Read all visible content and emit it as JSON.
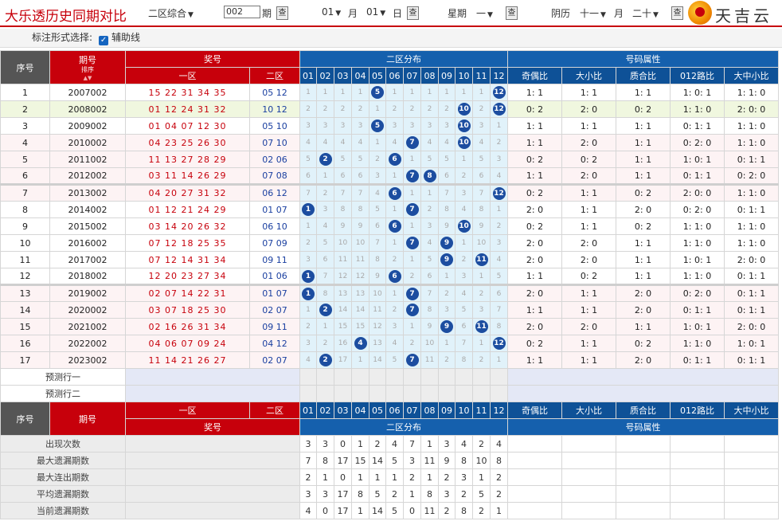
{
  "header": {
    "title": "大乐透历史同期对比",
    "zone_select": "二区综合",
    "period_input": "002",
    "period_label": "期",
    "query_label": "查",
    "month_value": "01",
    "month_label": "月",
    "day_value": "01",
    "day_label": "日",
    "weekday_label": "星期",
    "weekday_value": "一",
    "lunar_label": "阴历",
    "lunar_month": "十一",
    "lunar_month_label": "月",
    "lunar_day": "二十",
    "logo_text": "天吉云"
  },
  "options": {
    "label": "标注形式选择:",
    "checkbox_label": "辅助线",
    "checked": true
  },
  "table": {
    "head1": {
      "seq": "序号",
      "period": "期号",
      "sort": "排序",
      "prize": "奖号",
      "dist": "二区分布",
      "attrs": "号码属性"
    },
    "head2": {
      "zone1": "一区",
      "zone2": "二区",
      "nums": [
        "01",
        "02",
        "03",
        "04",
        "05",
        "06",
        "07",
        "08",
        "09",
        "10",
        "11",
        "12"
      ],
      "attr_cols": [
        "奇偶比",
        "大小比",
        "质合比",
        "012路比",
        "大中小比"
      ]
    },
    "rows": [
      {
        "seq": "1",
        "period": "2007002",
        "front": "15 22 31 34 35",
        "back": "05 12",
        "dist": [
          "1",
          "1",
          "1",
          "1",
          "5",
          "1",
          "1",
          "1",
          "1",
          "1",
          "1",
          "12"
        ],
        "hits": [
          5,
          12
        ],
        "attrs": [
          "1: 1",
          "1: 1",
          "1: 1",
          "1: 0: 1",
          "1: 1: 0"
        ]
      },
      {
        "seq": "2",
        "period": "2008002",
        "front": "01 12 24 31 32",
        "back": "10 12",
        "dist": [
          "2",
          "2",
          "2",
          "2",
          "1",
          "2",
          "2",
          "2",
          "2",
          "10",
          "2",
          "12"
        ],
        "hits": [
          10,
          12
        ],
        "attrs": [
          "0: 2",
          "2: 0",
          "0: 2",
          "1: 1: 0",
          "2: 0: 0"
        ]
      },
      {
        "seq": "3",
        "period": "2009002",
        "front": "01 04 07 12 30",
        "back": "05 10",
        "dist": [
          "3",
          "3",
          "3",
          "3",
          "5",
          "3",
          "3",
          "3",
          "3",
          "10",
          "3",
          "1"
        ],
        "hits": [
          5,
          10
        ],
        "attrs": [
          "1: 1",
          "1: 1",
          "1: 1",
          "0: 1: 1",
          "1: 1: 0"
        ]
      },
      {
        "seq": "4",
        "period": "2010002",
        "front": "04 23 25 26 30",
        "back": "07 10",
        "dist": [
          "4",
          "4",
          "4",
          "4",
          "1",
          "4",
          "7",
          "4",
          "4",
          "10",
          "4",
          "2"
        ],
        "hits": [
          7,
          10
        ],
        "attrs": [
          "1: 1",
          "2: 0",
          "1: 1",
          "0: 2: 0",
          "1: 1: 0"
        ]
      },
      {
        "seq": "5",
        "period": "2011002",
        "front": "11 13 27 28 29",
        "back": "02 06",
        "dist": [
          "5",
          "2",
          "5",
          "5",
          "2",
          "6",
          "1",
          "5",
          "5",
          "1",
          "5",
          "3"
        ],
        "hits": [
          2,
          6
        ],
        "attrs": [
          "0: 2",
          "0: 2",
          "1: 1",
          "1: 0: 1",
          "0: 1: 1"
        ]
      },
      {
        "seq": "6",
        "period": "2012002",
        "front": "03 11 14 26 29",
        "back": "07 08",
        "dist": [
          "6",
          "1",
          "6",
          "6",
          "3",
          "1",
          "7",
          "8",
          "6",
          "2",
          "6",
          "4"
        ],
        "hits": [
          7,
          8
        ],
        "attrs": [
          "1: 1",
          "2: 0",
          "1: 1",
          "0: 1: 1",
          "0: 2: 0"
        ]
      },
      {
        "seq": "7",
        "period": "2013002",
        "front": "04 20 27 31 32",
        "back": "06 12",
        "dist": [
          "7",
          "2",
          "7",
          "7",
          "4",
          "6",
          "1",
          "1",
          "7",
          "3",
          "7",
          "12"
        ],
        "hits": [
          6,
          12
        ],
        "attrs": [
          "0: 2",
          "1: 1",
          "0: 2",
          "2: 0: 0",
          "1: 1: 0"
        ]
      },
      {
        "seq": "8",
        "period": "2014002",
        "front": "01 12 21 24 29",
        "back": "01 07",
        "dist": [
          "1",
          "3",
          "8",
          "8",
          "5",
          "1",
          "7",
          "2",
          "8",
          "4",
          "8",
          "1"
        ],
        "hits": [
          1,
          7
        ],
        "attrs": [
          "2: 0",
          "1: 1",
          "2: 0",
          "0: 2: 0",
          "0: 1: 1"
        ]
      },
      {
        "seq": "9",
        "period": "2015002",
        "front": "03 14 20 26 32",
        "back": "06 10",
        "dist": [
          "1",
          "4",
          "9",
          "9",
          "6",
          "6",
          "1",
          "3",
          "9",
          "10",
          "9",
          "2"
        ],
        "hits": [
          6,
          10
        ],
        "attrs": [
          "0: 2",
          "1: 1",
          "0: 2",
          "1: 1: 0",
          "1: 1: 0"
        ]
      },
      {
        "seq": "10",
        "period": "2016002",
        "front": "07 12 18 25 35",
        "back": "07 09",
        "dist": [
          "2",
          "5",
          "10",
          "10",
          "7",
          "1",
          "7",
          "4",
          "9",
          "1",
          "10",
          "3"
        ],
        "hits": [
          7,
          9
        ],
        "attrs": [
          "2: 0",
          "2: 0",
          "1: 1",
          "1: 1: 0",
          "1: 1: 0"
        ]
      },
      {
        "seq": "11",
        "period": "2017002",
        "front": "07 12 14 31 34",
        "back": "09 11",
        "dist": [
          "3",
          "6",
          "11",
          "11",
          "8",
          "2",
          "1",
          "5",
          "9",
          "2",
          "11",
          "4"
        ],
        "hits": [
          9,
          11
        ],
        "attrs": [
          "2: 0",
          "2: 0",
          "1: 1",
          "1: 0: 1",
          "2: 0: 0"
        ]
      },
      {
        "seq": "12",
        "period": "2018002",
        "front": "12 20 23 27 34",
        "back": "01 06",
        "dist": [
          "1",
          "7",
          "12",
          "12",
          "9",
          "6",
          "2",
          "6",
          "1",
          "3",
          "1",
          "5"
        ],
        "hits": [
          1,
          6
        ],
        "attrs": [
          "1: 1",
          "0: 2",
          "1: 1",
          "1: 1: 0",
          "0: 1: 1"
        ]
      },
      {
        "seq": "13",
        "period": "2019002",
        "front": "02 07 14 22 31",
        "back": "01 07",
        "dist": [
          "1",
          "8",
          "13",
          "13",
          "10",
          "1",
          "7",
          "7",
          "2",
          "4",
          "2",
          "6"
        ],
        "hits": [
          1,
          7
        ],
        "attrs": [
          "2: 0",
          "1: 1",
          "2: 0",
          "0: 2: 0",
          "0: 1: 1"
        ]
      },
      {
        "seq": "14",
        "period": "2020002",
        "front": "03 07 18 25 30",
        "back": "02 07",
        "dist": [
          "1",
          "2",
          "14",
          "14",
          "11",
          "2",
          "7",
          "8",
          "3",
          "5",
          "3",
          "7"
        ],
        "hits": [
          2,
          7
        ],
        "attrs": [
          "1: 1",
          "1: 1",
          "2: 0",
          "0: 1: 1",
          "0: 1: 1"
        ]
      },
      {
        "seq": "15",
        "period": "2021002",
        "front": "02 16 26 31 34",
        "back": "09 11",
        "dist": [
          "2",
          "1",
          "15",
          "15",
          "12",
          "3",
          "1",
          "9",
          "9",
          "6",
          "11",
          "8"
        ],
        "hits": [
          9,
          11
        ],
        "attrs": [
          "2: 0",
          "2: 0",
          "1: 1",
          "1: 0: 1",
          "2: 0: 0"
        ]
      },
      {
        "seq": "16",
        "period": "2022002",
        "front": "04 06 07 09 24",
        "back": "04 12",
        "dist": [
          "3",
          "2",
          "16",
          "4",
          "13",
          "4",
          "2",
          "10",
          "1",
          "7",
          "1",
          "12"
        ],
        "hits": [
          4,
          12
        ],
        "attrs": [
          "0: 2",
          "1: 1",
          "0: 2",
          "1: 1: 0",
          "1: 0: 1"
        ]
      },
      {
        "seq": "17",
        "period": "2023002",
        "front": "11 14 21 26 27",
        "back": "02 07",
        "dist": [
          "4",
          "2",
          "17",
          "1",
          "14",
          "5",
          "7",
          "11",
          "2",
          "8",
          "2",
          "1"
        ],
        "hits": [
          2,
          7
        ],
        "attrs": [
          "1: 1",
          "1: 1",
          "2: 0",
          "0: 1: 1",
          "0: 1: 1"
        ]
      }
    ],
    "predict": [
      "预测行一",
      "预测行二"
    ],
    "footer": {
      "seq": "序号",
      "period": "期号",
      "zone1": "一区",
      "zone2": "二区",
      "prize": "奖号",
      "dist": "二区分布",
      "attrs": "号码属性"
    },
    "stats": [
      {
        "label": "出现次数",
        "vals": [
          "3",
          "3",
          "0",
          "1",
          "2",
          "4",
          "7",
          "1",
          "3",
          "4",
          "2",
          "4"
        ]
      },
      {
        "label": "最大遗漏期数",
        "vals": [
          "7",
          "8",
          "17",
          "15",
          "14",
          "5",
          "3",
          "11",
          "9",
          "8",
          "10",
          "8"
        ]
      },
      {
        "label": "最大连出期数",
        "vals": [
          "2",
          "1",
          "0",
          "1",
          "1",
          "1",
          "2",
          "1",
          "2",
          "3",
          "1",
          "2"
        ]
      },
      {
        "label": "平均遗漏期数",
        "vals": [
          "3",
          "3",
          "17",
          "8",
          "5",
          "2",
          "1",
          "8",
          "3",
          "2",
          "5",
          "2"
        ]
      },
      {
        "label": "当前遗漏期数",
        "vals": [
          "4",
          "0",
          "17",
          "1",
          "14",
          "5",
          "0",
          "11",
          "2",
          "8",
          "2",
          "1"
        ]
      }
    ]
  }
}
